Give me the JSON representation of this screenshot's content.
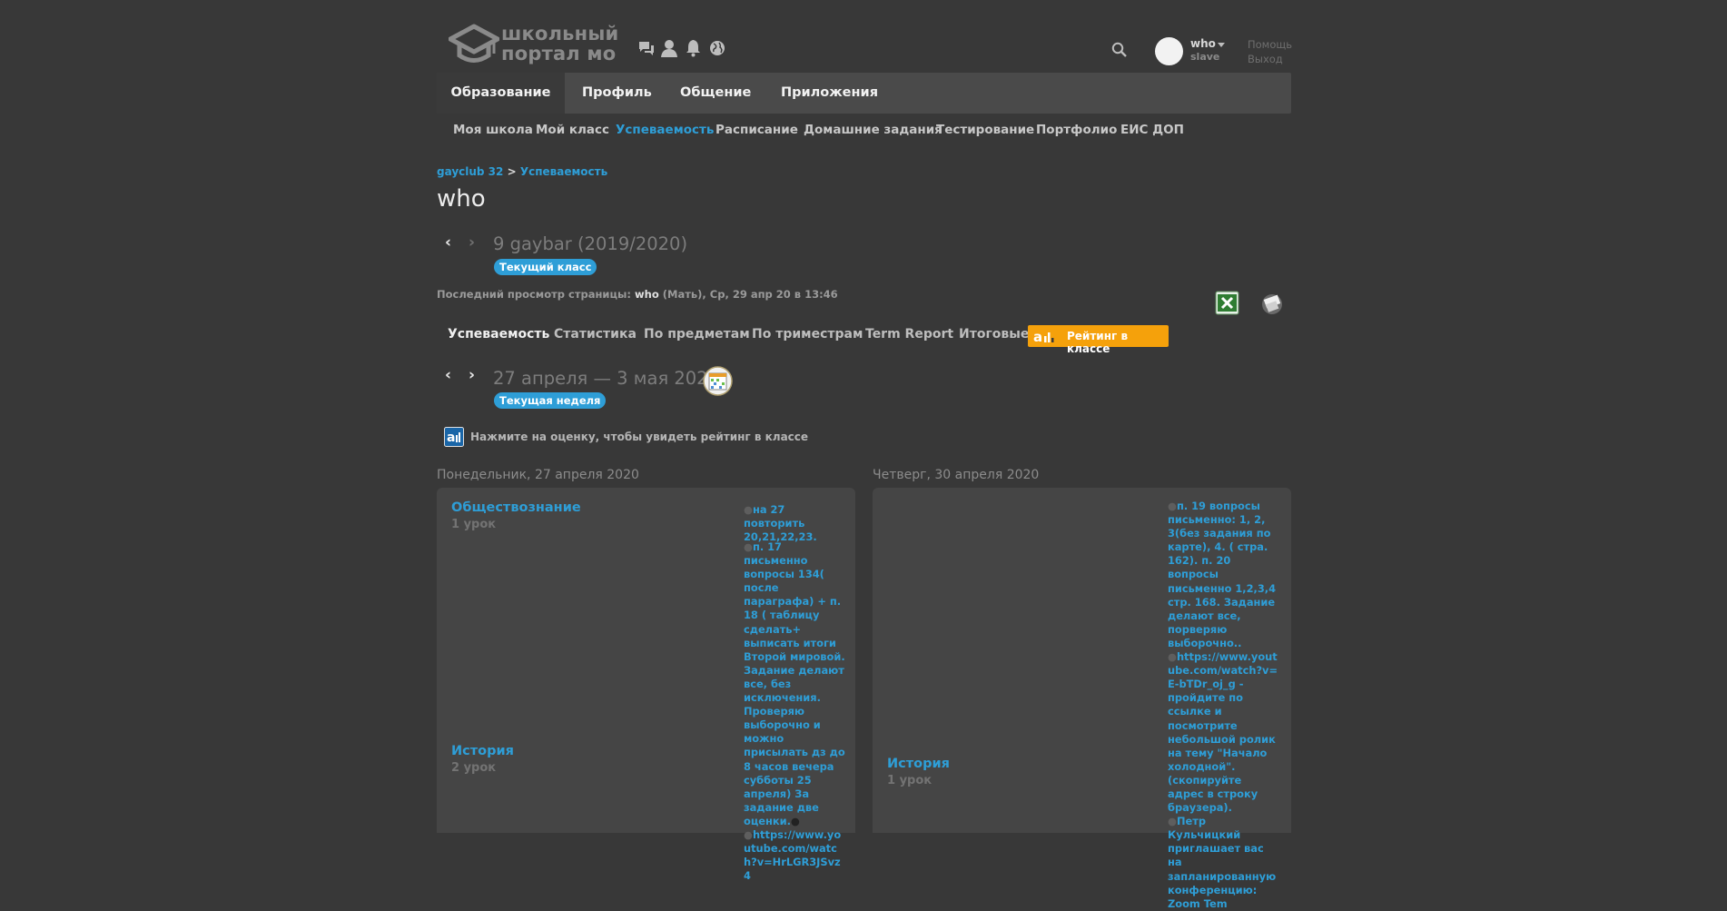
{
  "header": {
    "logo_line1": "школьный",
    "logo_line2": "портал мо",
    "user": {
      "name": "who",
      "sub": "slave"
    },
    "help": "Помощь",
    "logout": "Выход",
    "icons": [
      "chat-icon",
      "person-icon",
      "bell-icon",
      "globe-icon",
      "search-icon"
    ]
  },
  "main_nav": [
    "Образование",
    "Профиль",
    "Общение",
    "Приложения"
  ],
  "sub_nav": [
    "Моя школа",
    "Мой класс",
    "Успеваемость",
    "Расписание",
    "Домашние задания",
    "Тестирование",
    "Портфолио",
    "ЕИС ДОП"
  ],
  "breadcrumb": {
    "school": "gayclub 32",
    "sep": ">",
    "page": "Успеваемость"
  },
  "page_title": "who",
  "class_period": {
    "label": "9 gaybar (2019/2020)",
    "badge": "Текущий класс"
  },
  "last_view": {
    "prefix": "Последний просмотр страницы:",
    "who": "who",
    "rest": "(Мать), Ср, 29 апр 20 в 13:46"
  },
  "tabs": [
    "Успеваемость",
    "Статистика",
    "По предметам",
    "По триместрам",
    "Term Report",
    "Итоговые"
  ],
  "rating_button": "Рейтинг в классе",
  "week": {
    "label": "27 апреля — 3 мая 2020",
    "badge": "Текущая неделя"
  },
  "hint": "Нажмите на оценку, чтобы увидеть рейтинг в классе",
  "days": [
    {
      "title": "Понедельник, 27 апреля 2020",
      "lessons": [
        {
          "subject": "Обществознание",
          "count": "1 урок",
          "homework": "на 27 повторить 20,21,22,23."
        },
        {
          "subject": "История",
          "count": "2 урок",
          "homework": "п. 17 письменно вопросы 134( после параграфа) + п. 18 ( таблицу сделать+ выписать итоги Второй мировой. Задание делают все, без исключения. Проверяю выборочно и можно присылать дз до 8 часов вечера субботы 25 апреля) За задание две оценки.",
          "link": "https://www.youtube.com/watch?v=HrLGR3JSvz4"
        }
      ]
    },
    {
      "title": "Четверг, 30 апреля 2020",
      "lessons": [
        {
          "subject": "История",
          "count": "1 урок",
          "homework": "п. 19 вопросы письменно: 1, 2, 3(без задания по карте), 4. ( стра. 162). п. 20 вопросы письменно 1,2,3,4 стр. 168. Задание делают все, порверяю выборочно..",
          "link": "https://www.youtube.com/watch?v=E-bTDr_oj_g",
          "link_note": "- пройдите по ссылке и посмотрите небольшой ролик на тему \"Начало холодной\". (скопируйте адрес в строку браузера).",
          "note2": "Петр Кульчицкий приглашает вас на запланированную конференцию:",
          "note3": "Zoom Tem"
        }
      ]
    }
  ]
}
